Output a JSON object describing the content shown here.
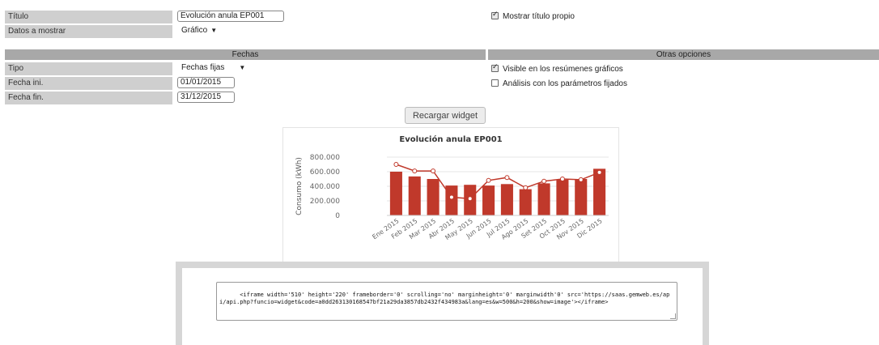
{
  "form": {
    "titulo": {
      "label": "Título",
      "value": "Evolución anula EP001"
    },
    "datos_mostrar": {
      "label": "Datos a mostrar",
      "value": "Gráfico"
    },
    "mostrar_titulo": {
      "label": "Mostrar título propio",
      "checked": true
    }
  },
  "fechas": {
    "header": "Fechas",
    "tipo": {
      "label": "Tipo",
      "value": "Fechas fijas"
    },
    "fecha_ini": {
      "label": "Fecha ini.",
      "value": "01/01/2015"
    },
    "fecha_fin": {
      "label": "Fecha fin.",
      "value": "31/12/2015"
    }
  },
  "otras": {
    "header": "Otras opciones",
    "visible": {
      "label": "Visible en los resúmenes gráficos",
      "checked": true
    },
    "analisis": {
      "label": "Análisis con los parámetros fijados",
      "checked": false
    }
  },
  "reload_button": "Recargar widget",
  "chart_data": {
    "type": "bar",
    "title": "Evolución anula EP001",
    "ylabel": "Consumo (kWh)",
    "xlabel": "",
    "ylim": [
      0,
      800000
    ],
    "yticks": [
      "800.000",
      "600.000",
      "400.000",
      "200.000",
      "0"
    ],
    "categories": [
      "Ene 2015",
      "Feb 2015",
      "Mar 2015",
      "Abr 2015",
      "May 2015",
      "Jun 2015",
      "Jul 2015",
      "Ago 2015",
      "Set 2015",
      "Oct 2015",
      "Nov 2015",
      "Dic 2015"
    ],
    "series": [
      {
        "values": [
          600000,
          535000,
          500000,
          410000,
          420000,
          410000,
          430000,
          360000,
          440000,
          490000,
          500000,
          640000
        ],
        "color": "#c0392b"
      },
      {
        "values": [
          700000,
          610000,
          610000,
          250000,
          230000,
          480000,
          520000,
          380000,
          470000,
          500000,
          490000,
          590000
        ],
        "color": "#c0392b"
      }
    ]
  },
  "embed_code": "<iframe width='510' height='220' frameborder='0' scrolling='no' marginheight='0' marginwidth'0' src='https://saas.gemweb.es/api/api.php?funcio=widget&code=a0dd263130168547bf21a29da3857db2432f434983a&lang=es&w=500&h=200&show=image'></iframe>"
}
